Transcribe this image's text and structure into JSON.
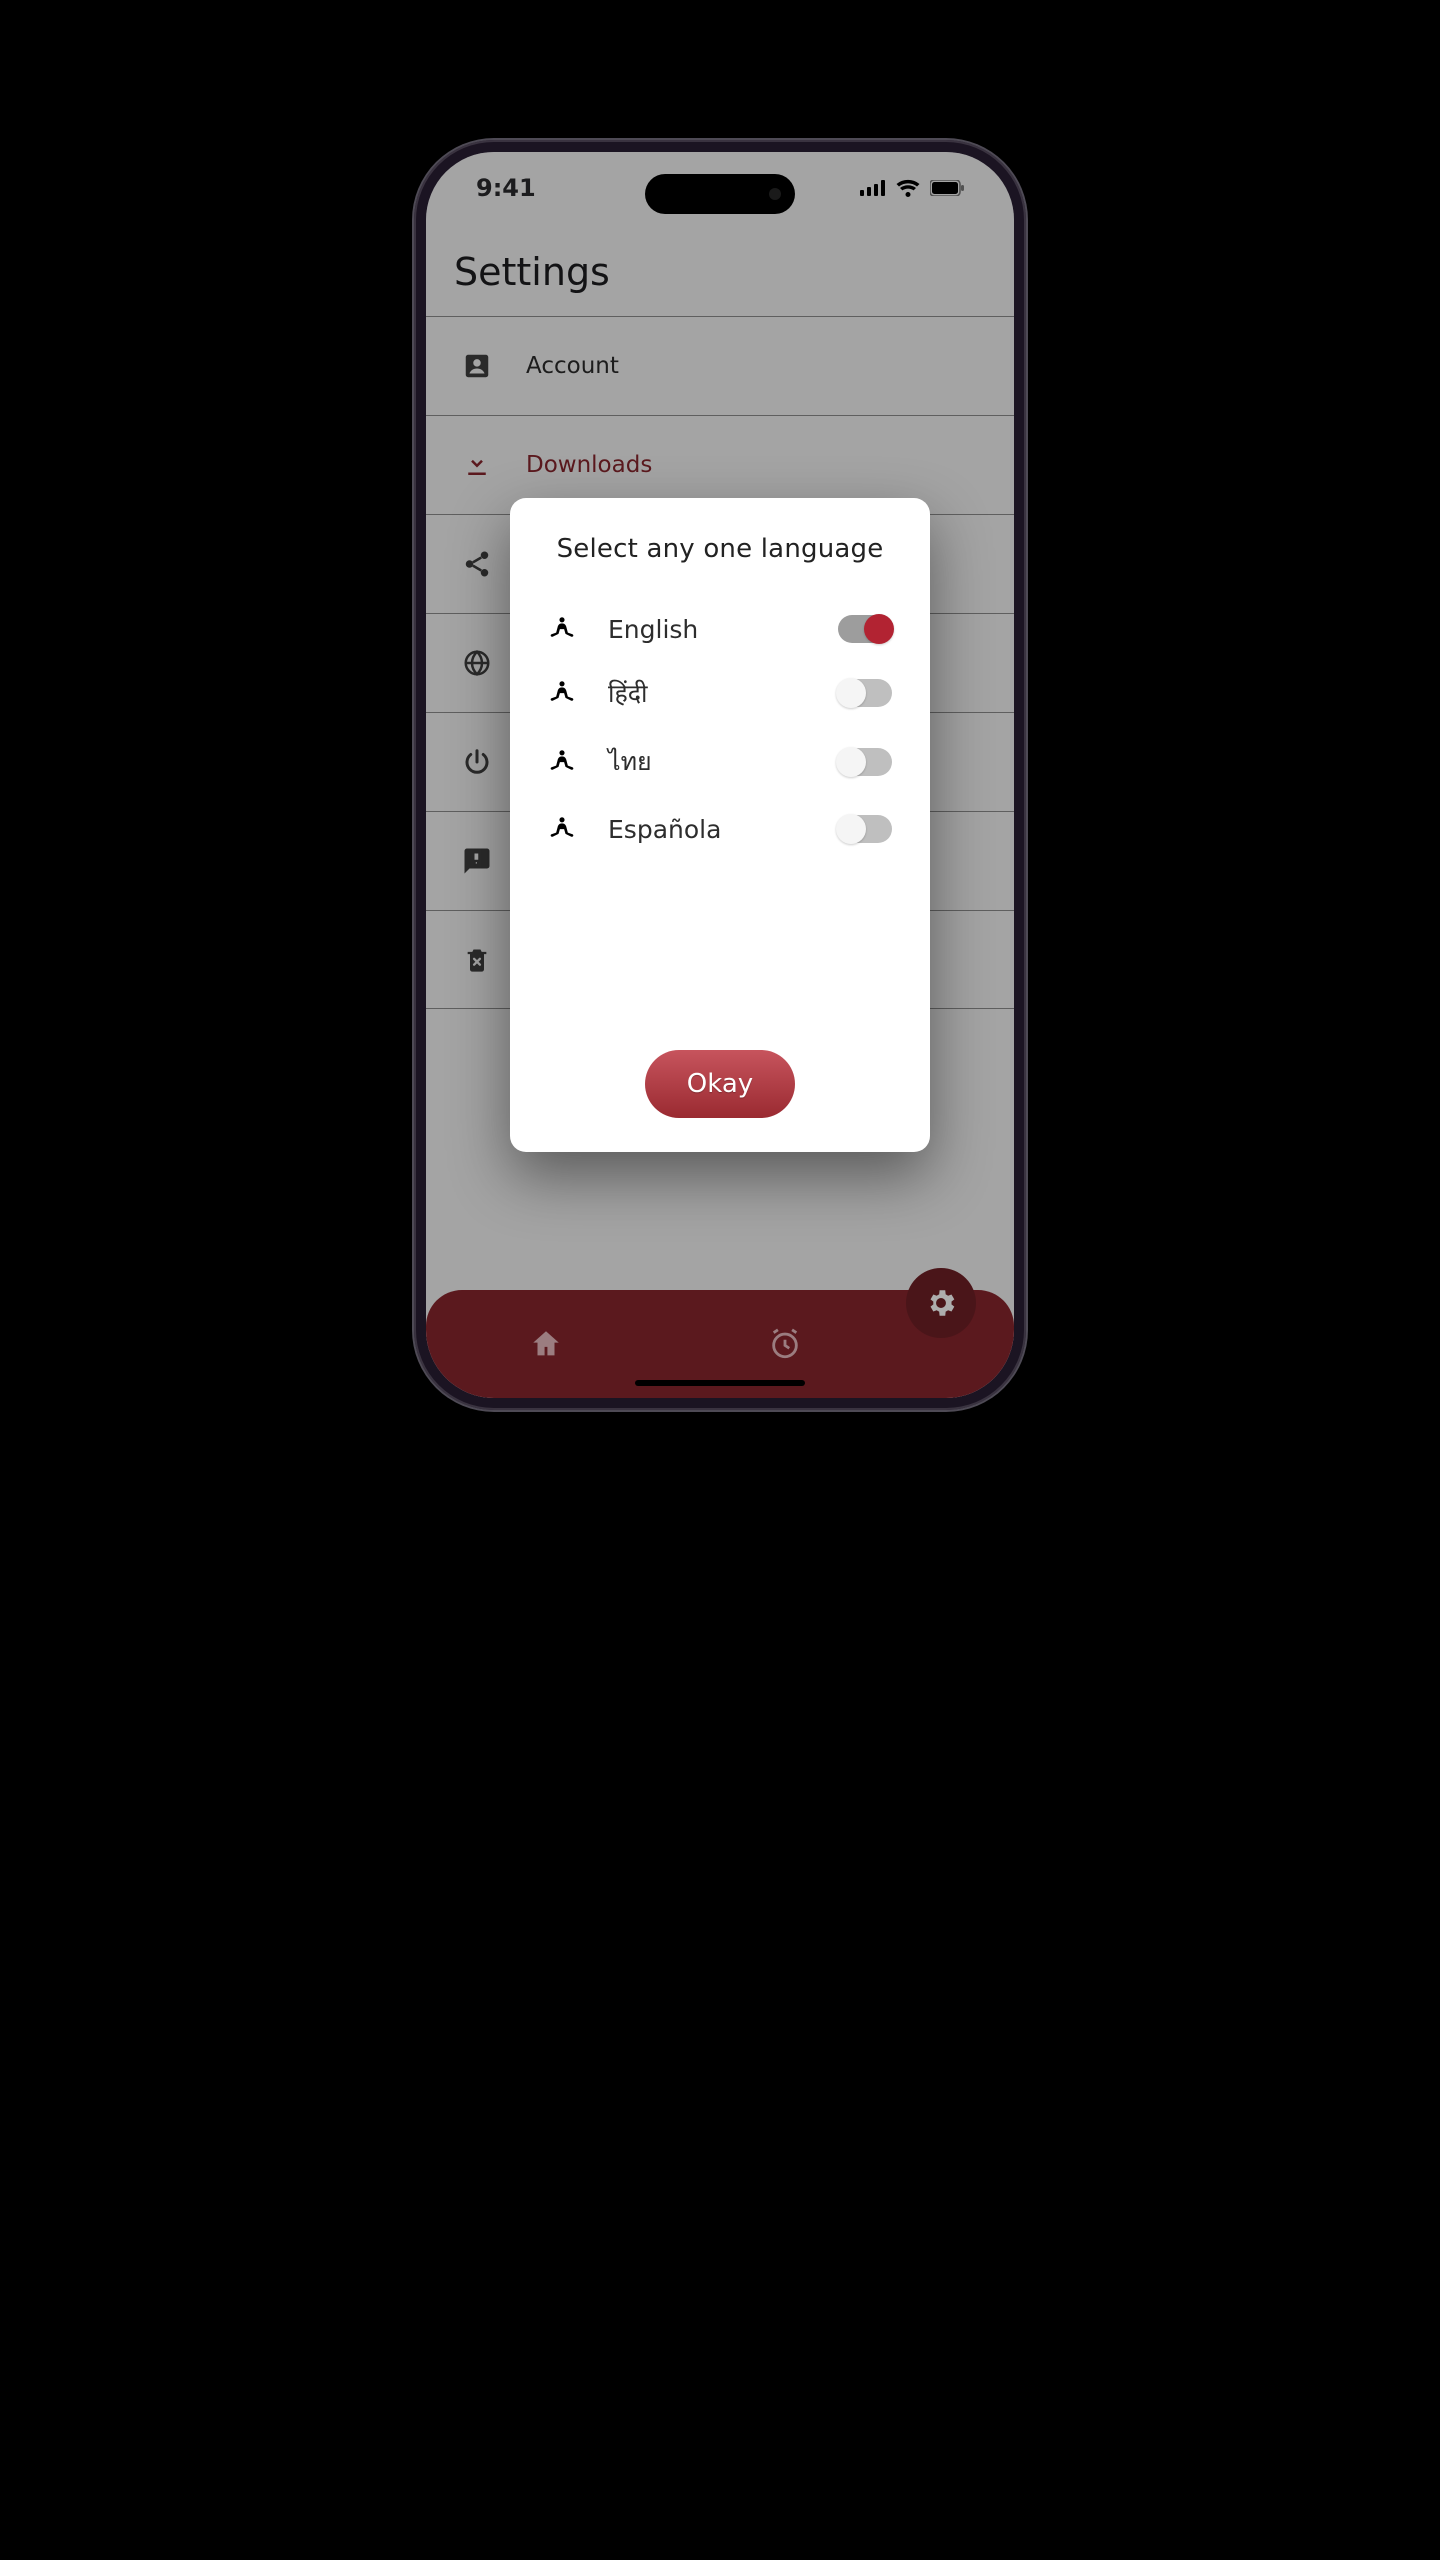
{
  "status": {
    "time": "9:41"
  },
  "page": {
    "title": "Settings"
  },
  "settings": {
    "rows": [
      {
        "label": "Account",
        "icon": "person",
        "highlight": false
      },
      {
        "label": "Downloads",
        "icon": "download",
        "highlight": true
      },
      {
        "label": "",
        "icon": "share",
        "highlight": false
      },
      {
        "label": "",
        "icon": "globe",
        "highlight": false
      },
      {
        "label": "",
        "icon": "power",
        "highlight": false
      },
      {
        "label": "",
        "icon": "feedback",
        "highlight": false
      },
      {
        "label": "",
        "icon": "delete",
        "highlight": false
      }
    ]
  },
  "modal": {
    "title": "Select any one language",
    "languages": [
      {
        "label": "English",
        "on": true
      },
      {
        "label": "हिंदी",
        "on": false
      },
      {
        "label": "ไทย",
        "on": false
      },
      {
        "label": "Española",
        "on": false
      }
    ],
    "ok_label": "Okay"
  },
  "colors": {
    "accent": "#86252d"
  }
}
